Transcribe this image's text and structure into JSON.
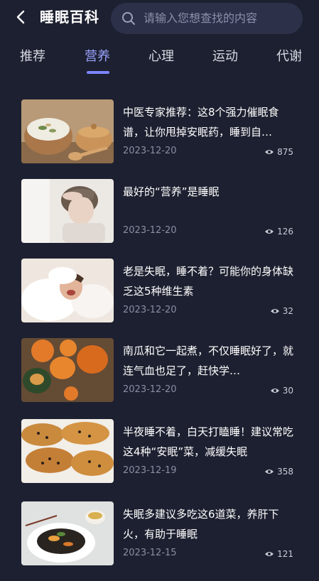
{
  "header": {
    "title": "睡眠百科",
    "search_placeholder": "请输入您想查找的内容"
  },
  "tabs": [
    {
      "label": "推荐",
      "active": false
    },
    {
      "label": "营养",
      "active": true
    },
    {
      "label": "心理",
      "active": false
    },
    {
      "label": "运动",
      "active": false
    },
    {
      "label": "代谢",
      "active": false
    }
  ],
  "articles": [
    {
      "title": "中医专家推荐：这8个强力催眠食谱，让你甩掉安眠药，睡到自…",
      "date": "2023-12-20",
      "views": "875"
    },
    {
      "title": "最好的“营养”是睡眠",
      "date": "2023-12-20",
      "views": "126"
    },
    {
      "title": "老是失眠，睡不着？可能你的身体缺乏这5种维生素",
      "date": "2023-12-20",
      "views": "32"
    },
    {
      "title": "南瓜和它一起煮，不仅睡眠好了，就连气血也足了，赶快学…",
      "date": "2023-12-20",
      "views": "30"
    },
    {
      "title": "半夜睡不着，白天打瞌睡！建议常吃这4种“安眠”菜，减缓失眠",
      "date": "2023-12-19",
      "views": "358"
    },
    {
      "title": "失眠多建议多吃这6道菜，养肝下火，有助于睡眠",
      "date": "2023-12-15",
      "views": "121"
    }
  ],
  "colors": {
    "background": "#1d2030",
    "accent": "#7b85ff",
    "search_bg": "#2c3049"
  }
}
